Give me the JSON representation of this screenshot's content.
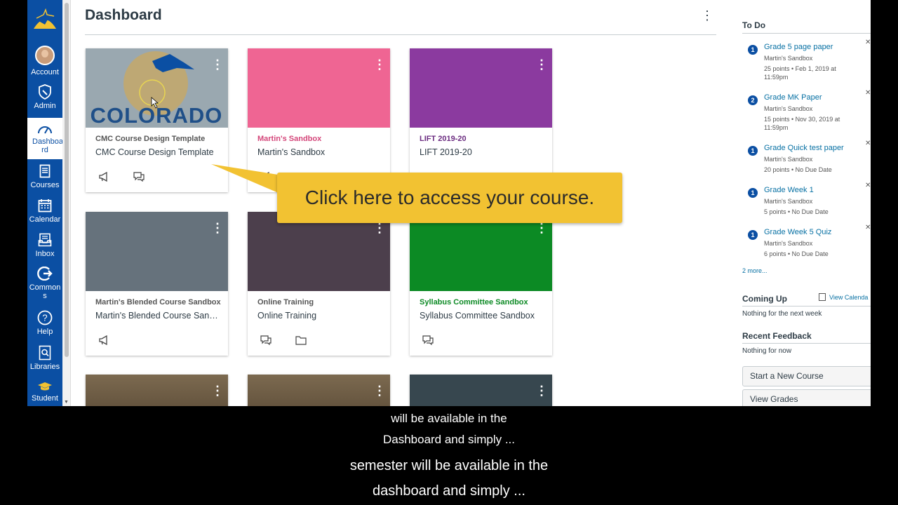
{
  "page": {
    "title": "Dashboard"
  },
  "global_nav": {
    "items": [
      {
        "label": "Account",
        "icon": "avatar"
      },
      {
        "label": "Admin",
        "icon": "shield-icon"
      },
      {
        "label": "Dashboa rd",
        "icon": "speedometer-icon",
        "active": true
      },
      {
        "label": "Courses",
        "icon": "book-icon"
      },
      {
        "label": "Calendar",
        "icon": "calendar-icon"
      },
      {
        "label": "Inbox",
        "icon": "inbox-icon"
      },
      {
        "label": "Common s",
        "icon": "share-arrow-icon"
      },
      {
        "label": "Help",
        "icon": "help-icon"
      },
      {
        "label": "Libraries",
        "icon": "library-search-icon"
      },
      {
        "label": "Student",
        "icon": "graduation-cap-icon"
      }
    ],
    "colors": {
      "nav_bg": "#0b4fa3",
      "logo": "#f2c232"
    }
  },
  "courses": [
    {
      "sub": "CMC Course Design Template",
      "name": "CMC Course Design Template",
      "color": "#9aa8b0",
      "sub_color": "#555555",
      "hero_text": "COLORADO",
      "icons": [
        "announcement-icon",
        "discussion-icon"
      ]
    },
    {
      "sub": "Martin's Sandbox",
      "name": "Martin's Sandbox",
      "color": "#ef6593",
      "sub_color": "#d4467a",
      "icons": [
        "announcement-icon",
        "assignment-icon",
        "discussion-icon",
        "folder-icon"
      ]
    },
    {
      "sub": "LIFT 2019-20",
      "name": "LIFT 2019-20",
      "color": "#8b3a9f",
      "sub_color": "#6b2c80",
      "icons": [
        "announcement-icon",
        "discussion-icon",
        "folder-icon",
        "assignment-icon"
      ]
    },
    {
      "sub": "Martin's Blended Course Sandbox",
      "name": "Martin's Blended Course Sand...",
      "color": "#66727c",
      "sub_color": "#555555",
      "icons": [
        "announcement-icon"
      ]
    },
    {
      "sub": "Online Training",
      "name": "Online Training",
      "color": "#4c3f4c",
      "sub_color": "#555555",
      "icons": [
        "discussion-icon",
        "folder-icon"
      ]
    },
    {
      "sub": "Syllabus Committee Sandbox",
      "name": "Syllabus Committee Sandbox",
      "color": "#0c8a24",
      "sub_color": "#0c8a24",
      "icons": [
        "discussion-icon"
      ]
    },
    {
      "sub": "",
      "name": "",
      "color": "#6b5a44"
    },
    {
      "sub": "",
      "name": "",
      "color": "#6b5a44"
    },
    {
      "sub": "",
      "name": "",
      "color": "#37474f"
    }
  ],
  "callout": {
    "text": "Click here to access your course.",
    "color": "#f2c232"
  },
  "todo": {
    "heading": "To Do",
    "items": [
      {
        "count": "1",
        "title": "Grade 5 page paper",
        "course": "Martin's Sandbox",
        "meta": "25 points • Feb 1, 2019 at 11:59pm"
      },
      {
        "count": "2",
        "title": "Grade MK Paper",
        "course": "Martin's Sandbox",
        "meta": "15 points • Nov 30, 2019 at 11:59pm"
      },
      {
        "count": "1",
        "title": "Grade Quick test paper",
        "course": "Martin's Sandbox",
        "meta": "20 points • No Due Date"
      },
      {
        "count": "1",
        "title": "Grade Week 1",
        "course": "Martin's Sandbox",
        "meta": "5 points • No Due Date"
      },
      {
        "count": "1",
        "title": "Grade Week 5 Quiz",
        "course": "Martin's Sandbox",
        "meta": "6 points • No Due Date"
      }
    ],
    "more": "2 more..."
  },
  "coming_up": {
    "heading": "Coming Up",
    "link": "View Calenda",
    "text": "Nothing for the next week"
  },
  "recent_feedback": {
    "heading": "Recent Feedback",
    "text": "Nothing for now"
  },
  "buttons": {
    "new_course": "Start a New Course",
    "view_grades": "View Grades"
  },
  "captions": {
    "line1": "will be available in the",
    "line2": "Dashboard and simply ...",
    "line3": "semester will be available in the",
    "line4": "dashboard and simply ..."
  }
}
